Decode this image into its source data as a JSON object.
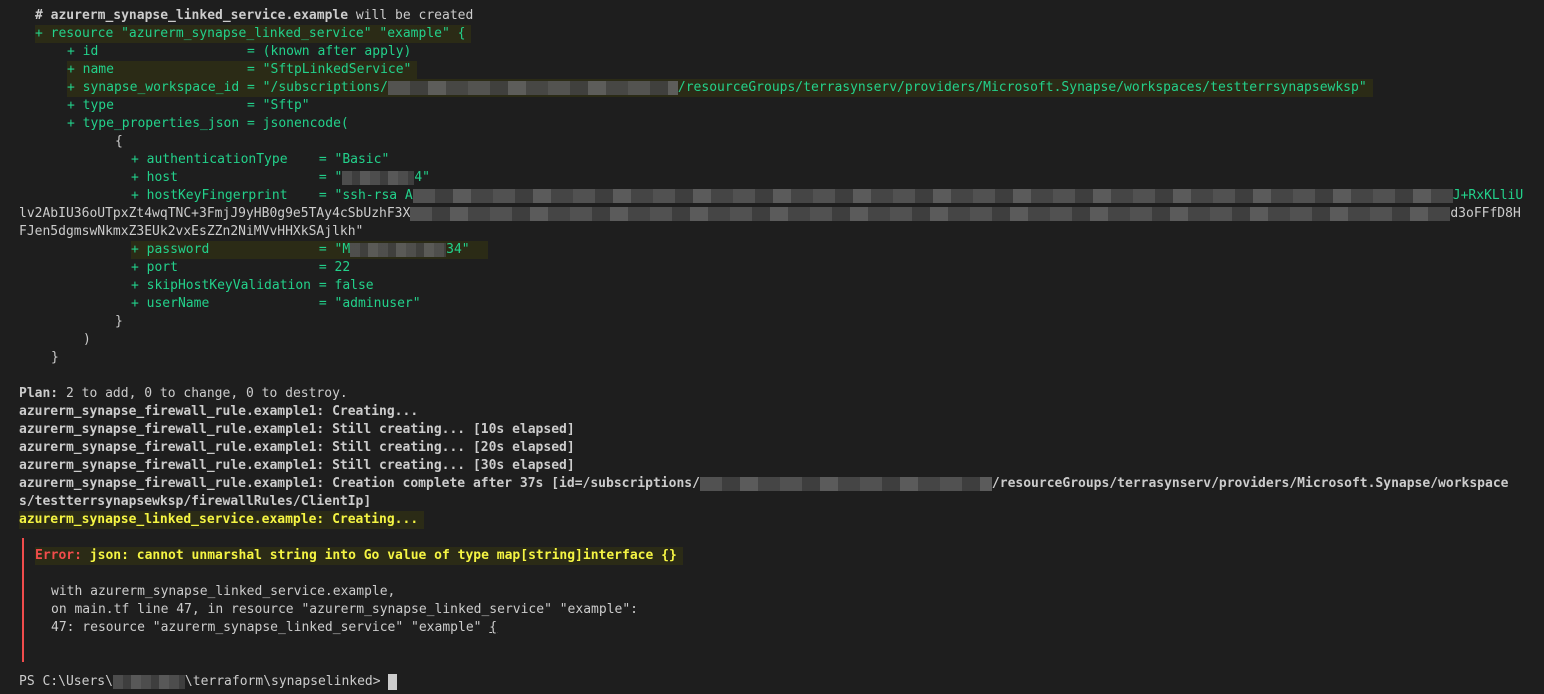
{
  "plan_block": {
    "comment_prefix": "# ",
    "comment_resource": "azurerm_synapse_linked_service.example",
    "comment_suffix": " will be created",
    "resource_line": "+ resource \"azurerm_synapse_linked_service\" \"example\" {",
    "attributes": {
      "id": "+ id                   = (known after apply)",
      "name": "+ name                 = \"SftpLinkedService\"",
      "workspace_prefix": "+ synapse_workspace_id = \"/subscriptions/",
      "workspace_suffix": "/resourceGroups/terrasynserv/providers/Microsoft.Synapse/workspaces/testterrsynapsewksp\"",
      "type": "+ type                 = \"Sftp\"",
      "type_properties": "+ type_properties_json = jsonencode("
    },
    "open_brace": "{",
    "json_props": {
      "auth": "+ authenticationType    = \"Basic\"",
      "host_prefix": "+ host                  = \"",
      "host_suffix": "4\"",
      "fingerprint_prefix": "+ hostKeyFingerprint    = \"ssh-rsa A",
      "fingerprint_tail1": "J+RxKLliU",
      "fp_line2_start": "lv2AbIU36oUTpxZt4wqTNC+3FmjJ9yHB0g9e5TAy4cSbUzhF3X",
      "fp_line2_end": "d3oFFfD8H",
      "fp_line3": "FJen5dgmswNkmxZ3EUk2vxEsZZn2NiMVvHHXkSAjlkh\"",
      "password_prefix": "+ password              = \"M",
      "password_suffix": "34\"",
      "port": "+ port                  = 22",
      "skip": "+ skipHostKeyValidation = false",
      "user": "+ userName              = \"adminuser\""
    },
    "close_brace": "}",
    "close_paren": ")",
    "close_resource": "}"
  },
  "plan_summary": {
    "label": "Plan:",
    "text": " 2 to add, 0 to change, 0 to destroy."
  },
  "apply_log": [
    "azurerm_synapse_firewall_rule.example1: Creating...",
    "azurerm_synapse_firewall_rule.example1: Still creating... [10s elapsed]",
    "azurerm_synapse_firewall_rule.example1: Still creating... [20s elapsed]",
    "azurerm_synapse_firewall_rule.example1: Still creating... [30s elapsed]"
  ],
  "creation_complete": {
    "prefix": "azurerm_synapse_firewall_rule.example1: Creation complete after 37s [id=/subscriptions/",
    "suffix": "/resourceGroups/terrasynserv/providers/Microsoft.Synapse/workspace",
    "wrap": "s/testterrsynapsewksp/firewallRules/ClientIp]"
  },
  "linked_creating": "azurerm_synapse_linked_service.example: Creating...",
  "error": {
    "label": "Error:",
    "message": " json: cannot unmarshal string into Go value of type map[string]interface {}",
    "with_line": "with azurerm_synapse_linked_service.example,",
    "on_line": "on main.tf line 47, in resource \"azurerm_synapse_linked_service\" \"example\":",
    "code_line_prefix": "47: resource \"azurerm_synapse_linked_service\" \"example\" ",
    "code_line_brace": "{"
  },
  "prompt": {
    "prefix": "PS C:\\Users\\",
    "suffix": "\\terraform\\synapselinked>"
  },
  "colors": {
    "background": "#1e1e1e",
    "text": "#cccccc",
    "added": "#23d18b",
    "warning": "#f5f543",
    "error": "#f14c4c"
  }
}
